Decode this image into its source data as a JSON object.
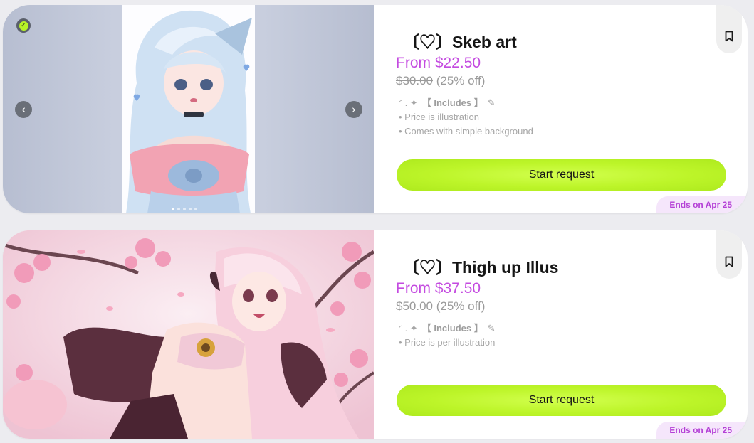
{
  "listings": [
    {
      "title": "〔♡〕Skeb art",
      "price": "From $22.50",
      "original_price": "$30.00",
      "discount": "(25% off)",
      "includes_prefix": "◜ . ✦",
      "includes_label": "【 Includes 】",
      "includes_suffix": "✎",
      "bullets": [
        "Price is illustration",
        "Comes with simple background"
      ],
      "cta_label": "Start request",
      "ends_label": "Ends on Apr 25",
      "image_slides": 5,
      "active_slide": 1
    },
    {
      "title": "〔♡〕Thigh up Illus",
      "price": "From $37.50",
      "original_price": "$50.00",
      "discount": "(25% off)",
      "includes_prefix": "◜ . ✦",
      "includes_label": "【 Includes 】",
      "includes_suffix": "✎",
      "bullets": [
        "Price is per illustration"
      ],
      "cta_label": "Start request",
      "ends_label": "Ends on Apr 25"
    }
  ],
  "colors": {
    "accent_price": "#c44be0",
    "cta_green": "#bdf529",
    "ends_text": "#b43fd6",
    "ends_bg": "#f5e6fb"
  },
  "icons": {
    "verified": "verified-check-icon",
    "prev": "chevron-left-icon",
    "next": "chevron-right-icon",
    "bookmark": "bookmark-icon"
  }
}
